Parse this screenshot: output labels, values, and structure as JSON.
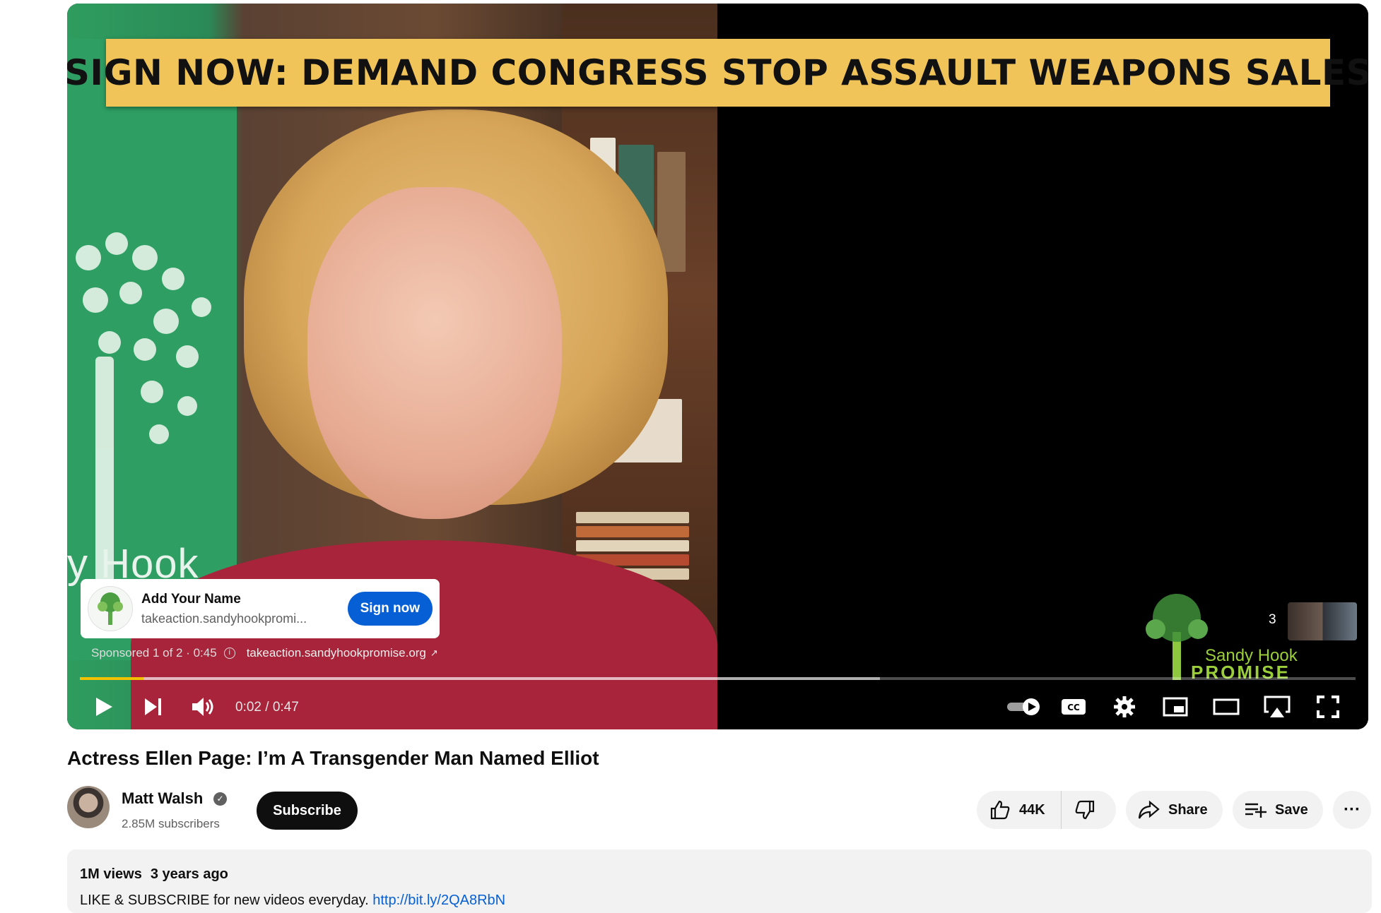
{
  "player": {
    "banner_text": "SIGN NOW: DEMAND CONGRESS STOP ASSAULT WEAPONS SALES",
    "background_text": "y Hook",
    "ad_card": {
      "title": "Add Your Name",
      "url": "takeaction.sandyhookpromi...",
      "cta_label": "Sign now"
    },
    "sponsored": {
      "label": "Sponsored 1 of 2 · 0:45",
      "domain": "takeaction.sandyhookpromise.org"
    },
    "watermark": {
      "line1": "Sandy Hook",
      "line2": "PROMISE"
    },
    "ad_count": "3",
    "progress": {
      "played_fraction": 0.05,
      "buffered_fraction": 0.627
    },
    "time": "0:02 / 0:47",
    "controls": {
      "play": "play-icon",
      "next": "next-icon",
      "volume": "volume-icon",
      "autoplay": "autoplay-toggle",
      "captions": "CC",
      "settings": "gear-icon",
      "miniplayer": "miniplayer-icon",
      "theater": "theater-icon",
      "airplay": "airplay-icon",
      "fullscreen": "fullscreen-icon"
    },
    "colors": {
      "banner": "#f1c45a",
      "progress": "#f2c200",
      "cta": "#065fd4"
    }
  },
  "video": {
    "title": "Actress Ellen Page: I’m A Transgender Man Named Elliot"
  },
  "channel": {
    "name": "Matt Walsh",
    "verified_glyph": "✓",
    "subscribers": "2.85M subscribers",
    "subscribe_label": "Subscribe"
  },
  "actions": {
    "like_count": "44K",
    "share_label": "Share",
    "save_label": "Save",
    "more_glyph": "···"
  },
  "description": {
    "views": "1M views",
    "age": "3 years ago",
    "text": "LIKE & SUBSCRIBE for new videos everyday. ",
    "link": "http://bit.ly/2QA8RbN"
  }
}
